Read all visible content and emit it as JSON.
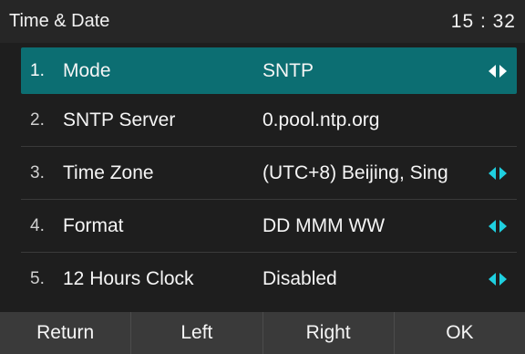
{
  "header": {
    "title": "Time & Date",
    "clock": "15 : 32"
  },
  "rows": [
    {
      "num": "1.",
      "label": "Mode",
      "value": "SNTP",
      "has_arrows": true,
      "selected": true
    },
    {
      "num": "2.",
      "label": "SNTP Server",
      "value": "0.pool.ntp.org",
      "has_arrows": false,
      "selected": false
    },
    {
      "num": "3.",
      "label": "Time Zone",
      "value": "(UTC+8) Beijing, Sing",
      "has_arrows": true,
      "selected": false
    },
    {
      "num": "4.",
      "label": "Format",
      "value": "DD MMM WW",
      "has_arrows": true,
      "selected": false
    },
    {
      "num": "5.",
      "label": "12 Hours Clock",
      "value": "Disabled",
      "has_arrows": true,
      "selected": false
    }
  ],
  "softkeys": {
    "return": "Return",
    "left": "Left",
    "right": "Right",
    "ok": "OK"
  },
  "colors": {
    "accent": "#0c6e72",
    "arrow": "#1fd0e0",
    "softkey_bar": "#3a3a3a"
  }
}
